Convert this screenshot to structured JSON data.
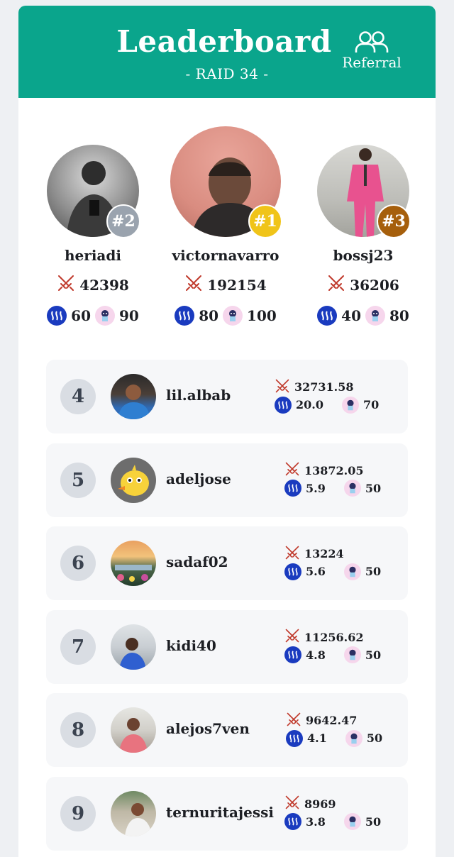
{
  "header": {
    "title": "Leaderboard",
    "subtitle": "- RAID 34 -",
    "referral_label": "Referral"
  },
  "colors": {
    "accent": "#0aa58c",
    "gold": "#f0c419",
    "silver": "#9aa3ae",
    "bronze": "#a65f0c",
    "steem": "#1a3bbf",
    "sword": "#c0392b"
  },
  "icons": {
    "damage": "crossed-swords-icon",
    "token": "steem-icon",
    "sticker": "character-sticker-icon",
    "referral": "users-icon"
  },
  "podium": [
    {
      "rank_label": "#2",
      "name": "heriadi",
      "damage": "42398",
      "steem": "60",
      "sticker": "90"
    },
    {
      "rank_label": "#1",
      "name": "victornavarro",
      "damage": "192154",
      "steem": "80",
      "sticker": "100"
    },
    {
      "rank_label": "#3",
      "name": "bossj23",
      "damage": "36206",
      "steem": "40",
      "sticker": "80"
    }
  ],
  "list": [
    {
      "rank": "4",
      "name": "lil.albab",
      "damage": "32731.58",
      "steem": "20.0",
      "sticker": "70"
    },
    {
      "rank": "5",
      "name": "adeljose",
      "damage": "13872.05",
      "steem": "5.9",
      "sticker": "50"
    },
    {
      "rank": "6",
      "name": "sadaf02",
      "damage": "13224",
      "steem": "5.6",
      "sticker": "50"
    },
    {
      "rank": "7",
      "name": "kidi40",
      "damage": "11256.62",
      "steem": "4.8",
      "sticker": "50"
    },
    {
      "rank": "8",
      "name": "alejos7ven",
      "damage": "9642.47",
      "steem": "4.1",
      "sticker": "50"
    },
    {
      "rank": "9",
      "name": "ternuritajessi",
      "damage": "8969",
      "steem": "3.8",
      "sticker": "50"
    }
  ]
}
